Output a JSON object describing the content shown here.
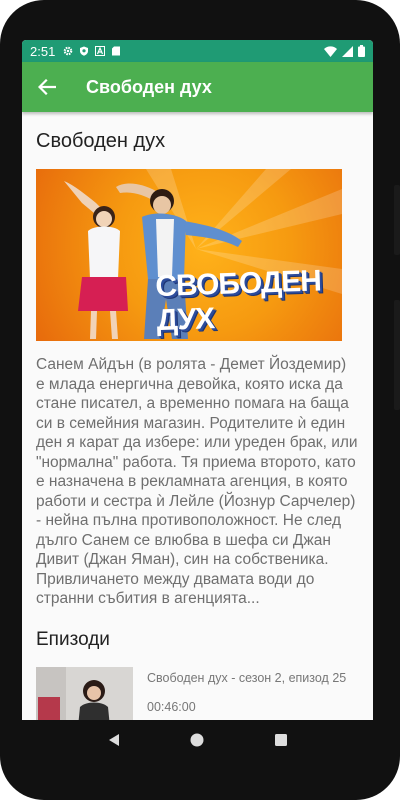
{
  "status_bar": {
    "time": "2:51",
    "color": "#1f9b74",
    "left_icons": [
      "gear-icon",
      "shield-icon",
      "a-icon",
      "sd-card-icon"
    ],
    "right_icons": [
      "wifi-icon",
      "signal-icon",
      "battery-icon"
    ]
  },
  "app_bar": {
    "title": "Свободен дух",
    "color": "#4caf50"
  },
  "show": {
    "title": "Свободен дух",
    "banner_text": "СВОБОДЕН ДУХ",
    "description": "Санем Айдън (в ролята - Демет Йоздемир) е млада енергична девойка, която иска да стане писател, а временно помага на баща си в семейния магазин. Родителите ѝ един ден я карат да избере: или уреден брак, или \"нормална\" работа. Тя приема второто, като е назначена в рекламната агенция, в която работи и сестра ѝ Лейле (Йознур Сарчелер) - нейна пълна противоположност. Не след дълго Санем се влюбва в шефа си Джан Дивит (Джан Яман), син на собственика. Привличането между двамата води до странни събития в агенцията..."
  },
  "episodes": {
    "section_title": "Епизоди",
    "items": [
      {
        "name": "Свободен дух - сезон 2, епизод 25",
        "duration": "00:46:00"
      }
    ]
  },
  "nav_bar": {
    "icons": [
      "back-triangle-icon",
      "home-circle-icon",
      "recents-square-icon"
    ]
  }
}
